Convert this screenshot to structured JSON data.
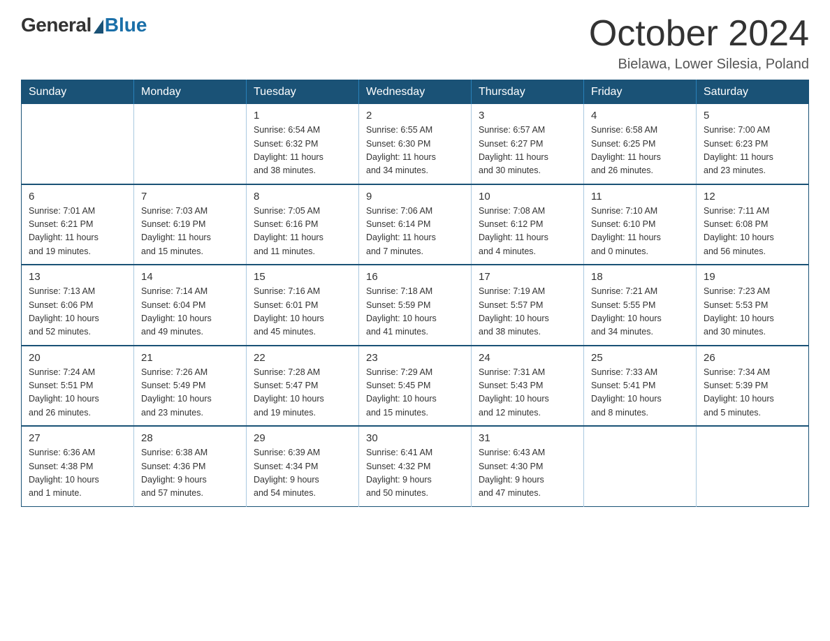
{
  "logo": {
    "general": "General",
    "blue": "Blue"
  },
  "title": "October 2024",
  "location": "Bielawa, Lower Silesia, Poland",
  "headers": [
    "Sunday",
    "Monday",
    "Tuesday",
    "Wednesday",
    "Thursday",
    "Friday",
    "Saturday"
  ],
  "weeks": [
    [
      {
        "day": "",
        "info": ""
      },
      {
        "day": "",
        "info": ""
      },
      {
        "day": "1",
        "info": "Sunrise: 6:54 AM\nSunset: 6:32 PM\nDaylight: 11 hours\nand 38 minutes."
      },
      {
        "day": "2",
        "info": "Sunrise: 6:55 AM\nSunset: 6:30 PM\nDaylight: 11 hours\nand 34 minutes."
      },
      {
        "day": "3",
        "info": "Sunrise: 6:57 AM\nSunset: 6:27 PM\nDaylight: 11 hours\nand 30 minutes."
      },
      {
        "day": "4",
        "info": "Sunrise: 6:58 AM\nSunset: 6:25 PM\nDaylight: 11 hours\nand 26 minutes."
      },
      {
        "day": "5",
        "info": "Sunrise: 7:00 AM\nSunset: 6:23 PM\nDaylight: 11 hours\nand 23 minutes."
      }
    ],
    [
      {
        "day": "6",
        "info": "Sunrise: 7:01 AM\nSunset: 6:21 PM\nDaylight: 11 hours\nand 19 minutes."
      },
      {
        "day": "7",
        "info": "Sunrise: 7:03 AM\nSunset: 6:19 PM\nDaylight: 11 hours\nand 15 minutes."
      },
      {
        "day": "8",
        "info": "Sunrise: 7:05 AM\nSunset: 6:16 PM\nDaylight: 11 hours\nand 11 minutes."
      },
      {
        "day": "9",
        "info": "Sunrise: 7:06 AM\nSunset: 6:14 PM\nDaylight: 11 hours\nand 7 minutes."
      },
      {
        "day": "10",
        "info": "Sunrise: 7:08 AM\nSunset: 6:12 PM\nDaylight: 11 hours\nand 4 minutes."
      },
      {
        "day": "11",
        "info": "Sunrise: 7:10 AM\nSunset: 6:10 PM\nDaylight: 11 hours\nand 0 minutes."
      },
      {
        "day": "12",
        "info": "Sunrise: 7:11 AM\nSunset: 6:08 PM\nDaylight: 10 hours\nand 56 minutes."
      }
    ],
    [
      {
        "day": "13",
        "info": "Sunrise: 7:13 AM\nSunset: 6:06 PM\nDaylight: 10 hours\nand 52 minutes."
      },
      {
        "day": "14",
        "info": "Sunrise: 7:14 AM\nSunset: 6:04 PM\nDaylight: 10 hours\nand 49 minutes."
      },
      {
        "day": "15",
        "info": "Sunrise: 7:16 AM\nSunset: 6:01 PM\nDaylight: 10 hours\nand 45 minutes."
      },
      {
        "day": "16",
        "info": "Sunrise: 7:18 AM\nSunset: 5:59 PM\nDaylight: 10 hours\nand 41 minutes."
      },
      {
        "day": "17",
        "info": "Sunrise: 7:19 AM\nSunset: 5:57 PM\nDaylight: 10 hours\nand 38 minutes."
      },
      {
        "day": "18",
        "info": "Sunrise: 7:21 AM\nSunset: 5:55 PM\nDaylight: 10 hours\nand 34 minutes."
      },
      {
        "day": "19",
        "info": "Sunrise: 7:23 AM\nSunset: 5:53 PM\nDaylight: 10 hours\nand 30 minutes."
      }
    ],
    [
      {
        "day": "20",
        "info": "Sunrise: 7:24 AM\nSunset: 5:51 PM\nDaylight: 10 hours\nand 26 minutes."
      },
      {
        "day": "21",
        "info": "Sunrise: 7:26 AM\nSunset: 5:49 PM\nDaylight: 10 hours\nand 23 minutes."
      },
      {
        "day": "22",
        "info": "Sunrise: 7:28 AM\nSunset: 5:47 PM\nDaylight: 10 hours\nand 19 minutes."
      },
      {
        "day": "23",
        "info": "Sunrise: 7:29 AM\nSunset: 5:45 PM\nDaylight: 10 hours\nand 15 minutes."
      },
      {
        "day": "24",
        "info": "Sunrise: 7:31 AM\nSunset: 5:43 PM\nDaylight: 10 hours\nand 12 minutes."
      },
      {
        "day": "25",
        "info": "Sunrise: 7:33 AM\nSunset: 5:41 PM\nDaylight: 10 hours\nand 8 minutes."
      },
      {
        "day": "26",
        "info": "Sunrise: 7:34 AM\nSunset: 5:39 PM\nDaylight: 10 hours\nand 5 minutes."
      }
    ],
    [
      {
        "day": "27",
        "info": "Sunrise: 6:36 AM\nSunset: 4:38 PM\nDaylight: 10 hours\nand 1 minute."
      },
      {
        "day": "28",
        "info": "Sunrise: 6:38 AM\nSunset: 4:36 PM\nDaylight: 9 hours\nand 57 minutes."
      },
      {
        "day": "29",
        "info": "Sunrise: 6:39 AM\nSunset: 4:34 PM\nDaylight: 9 hours\nand 54 minutes."
      },
      {
        "day": "30",
        "info": "Sunrise: 6:41 AM\nSunset: 4:32 PM\nDaylight: 9 hours\nand 50 minutes."
      },
      {
        "day": "31",
        "info": "Sunrise: 6:43 AM\nSunset: 4:30 PM\nDaylight: 9 hours\nand 47 minutes."
      },
      {
        "day": "",
        "info": ""
      },
      {
        "day": "",
        "info": ""
      }
    ]
  ]
}
